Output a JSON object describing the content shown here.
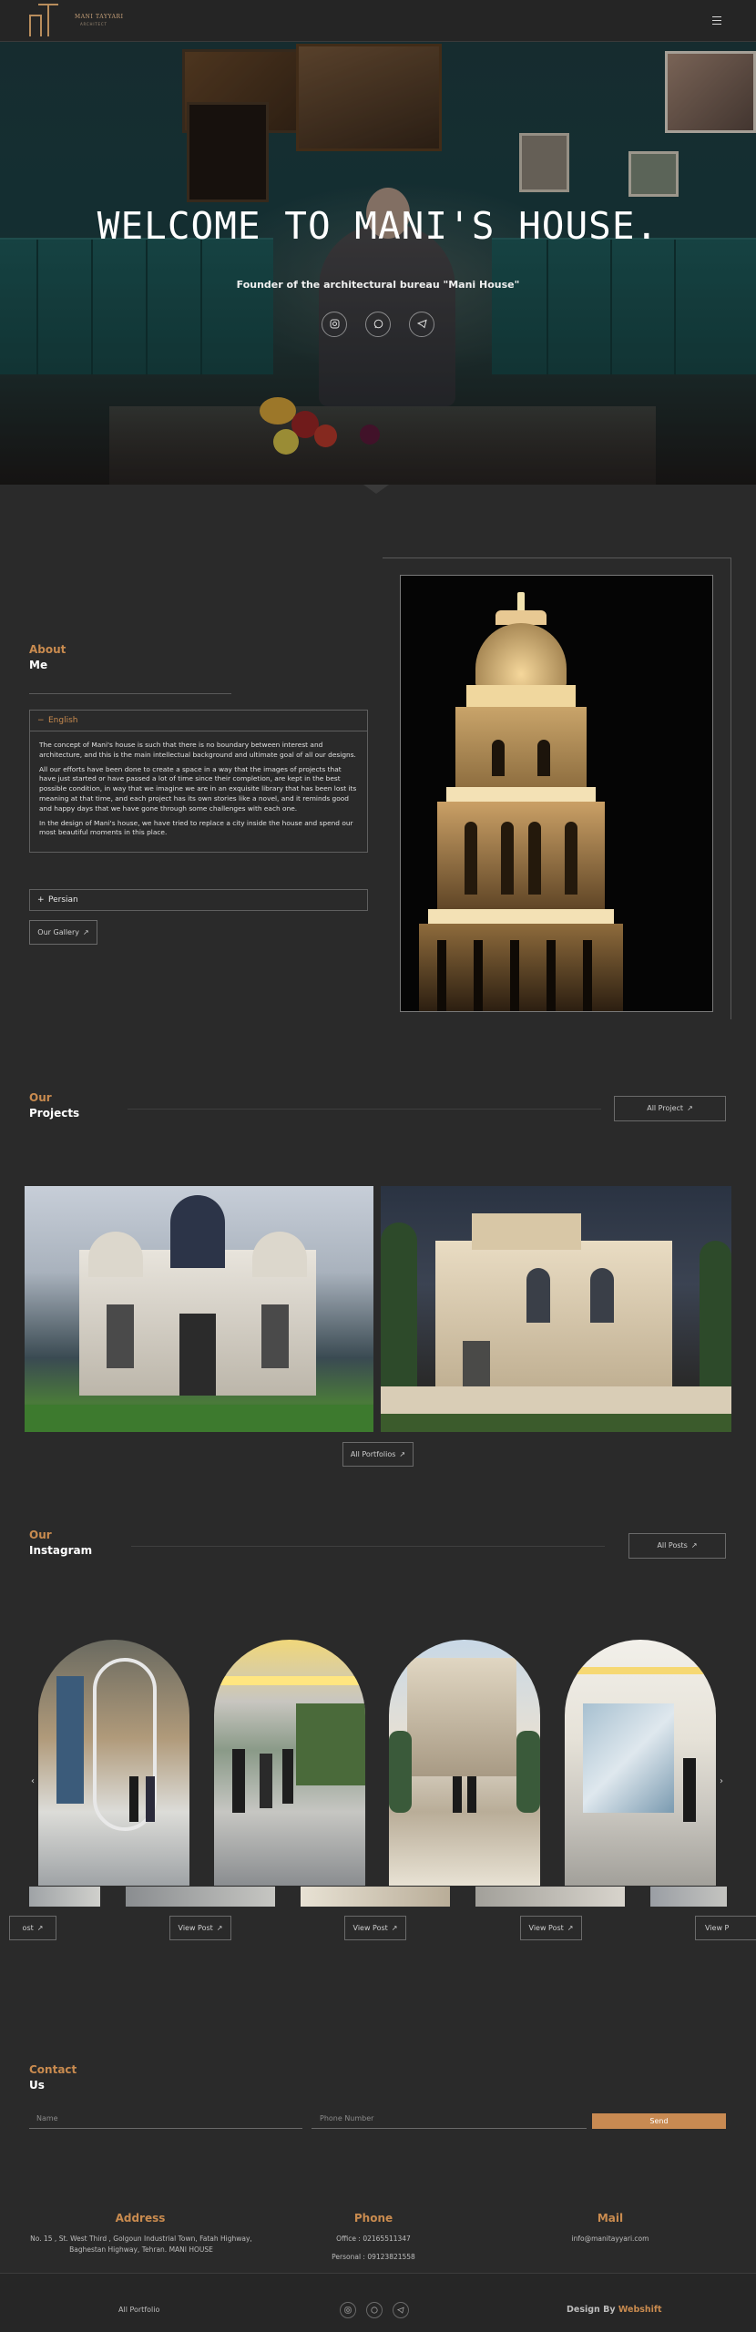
{
  "brand": {
    "logo_name": "MANI TAYYARI",
    "logo_subtitle": "ARCHITECT",
    "accent": "#c98b4f"
  },
  "header": {
    "menu_icon": "hamburger-icon"
  },
  "hero": {
    "title": "WELCOME TO MANI'S HOUSE.",
    "subtitle": "Founder of the architectural bureau \"Mani House\"",
    "socials": [
      "instagram-icon",
      "whatsapp-icon",
      "telegram-icon"
    ]
  },
  "about": {
    "title_top": "About",
    "title_bottom": "Me",
    "english_label": "English",
    "english_symbol": "−",
    "paragraphs": [
      "The concept of Mani's house is such that there is no boundary between interest and architecture, and this is the main intellectual background and ultimate goal of all our designs.",
      "All our efforts have been done to create a space in a way that the images of projects that have just started or have passed a lot of time since their completion, are kept in the best possible condition, in way that we imagine we are in an exquisite library that has been lost its meaning at that time, and each project has its own stories like a novel, and it reminds good and happy days that we have gone through some challenges with each one.",
      "In the design of Mani's house, we have tried to replace a city inside the house and spend our most beautiful moments in this place."
    ],
    "persian_label": "Persian",
    "persian_symbol": "+",
    "gallery_button": "Our Gallery",
    "arrow": "↗"
  },
  "projects": {
    "title_top": "Our",
    "title_bottom": "Projects",
    "all_button": "All Project",
    "portfolios_button": "All Portfolios",
    "arrow": "↗"
  },
  "instagram": {
    "title_top": "Our",
    "title_bottom": "Instagram",
    "all_button": "All Posts",
    "arrow": "↗",
    "prev": "‹",
    "next": "›",
    "view_posts": [
      "ost",
      "View Post",
      "View Post",
      "View Post",
      "View P"
    ]
  },
  "contact": {
    "title_top": "Contact",
    "title_bottom": "Us",
    "name_placeholder": "Name",
    "phone_placeholder": "Phone Number",
    "send": "Send"
  },
  "footer": {
    "address_title": "Address",
    "address_line1": "No. 15 , St. West Third , Golgoun Industrial Town, Fatah Highway,",
    "address_line2": "Baghestan Highway, Tehran. MANI HOUSE",
    "phone_title": "Phone",
    "office": "Office : 02165511347",
    "personal": "Personal : 09123821558",
    "mail_title": "Mail",
    "mail": "info@manitayyari.com",
    "portfolio_link": "All Portfolio",
    "design_by": "Design By",
    "design_company": "Webshift"
  }
}
